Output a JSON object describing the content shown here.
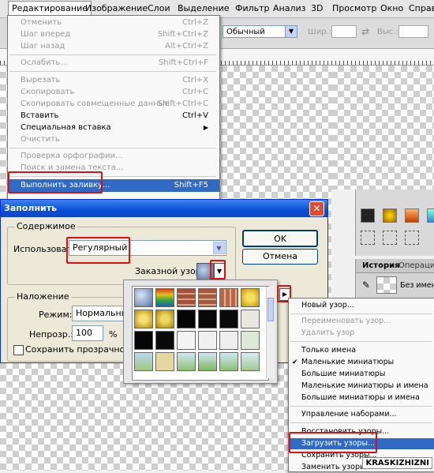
{
  "menubar": {
    "items": [
      "Редактирование",
      "Изображение",
      "Слои",
      "Выделение",
      "Фильтр",
      "Анализ",
      "3D",
      "Просмотр",
      "Окно",
      "Справ"
    ]
  },
  "options_bar": {
    "mode_value": "Обычный",
    "width_label": "Шир.:",
    "height_label": "Выс.:"
  },
  "edit_menu": {
    "items": [
      {
        "label": "Отменить",
        "shortcut": "Ctrl+Z"
      },
      {
        "label": "Шаг вперед",
        "shortcut": "Shift+Ctrl+Z"
      },
      {
        "label": "Шаг назад",
        "shortcut": "Alt+Ctrl+Z"
      },
      {
        "label": "Ослабить...",
        "shortcut": "Shift+Ctrl+F"
      },
      {
        "label": "Вырезать",
        "shortcut": "Ctrl+X"
      },
      {
        "label": "Скопировать",
        "shortcut": "Ctrl+C"
      },
      {
        "label": "Скопировать совмещенные данные",
        "shortcut": "Shift+Ctrl+C"
      },
      {
        "label": "Вставить",
        "shortcut": "Ctrl+V"
      },
      {
        "label": "Специальная вставка",
        "shortcut": ""
      },
      {
        "label": "Очистить",
        "shortcut": ""
      },
      {
        "label": "Проверка орфографии...",
        "shortcut": ""
      },
      {
        "label": "Поиск и замена текста...",
        "shortcut": ""
      },
      {
        "label": "Выполнить заливку...",
        "shortcut": "Shift+F5"
      }
    ]
  },
  "dialog": {
    "title": "Заполнить",
    "contents_legend": "Содержимое",
    "use_label": "Использовать:",
    "use_value": "Регулярный",
    "custom_pattern_label": "Заказной узор:",
    "blending_legend": "Наложение",
    "mode_label": "Режим:",
    "mode_value": "Нормальный",
    "opacity_label": "Непрозр.:",
    "opacity_value": "100",
    "opacity_unit": "%",
    "preserve_label": "Сохранить прозрачность",
    "ok": "OK",
    "cancel": "Отмена"
  },
  "panels": {
    "history_tab": "История",
    "operations_tab": "Операци",
    "history_item": "Без имени"
  },
  "flyout_menu": {
    "items": [
      "Новый узор...",
      "Переименовать узор...",
      "Удалить узор",
      "Только имена",
      "Маленькие миниатюры",
      "Большие миниатюры",
      "Маленькие миниатюры и имена",
      "Большие миниатюры и имена",
      "Управление наборами...",
      "Восстановить узоры...",
      "Загрузить узоры...",
      "Сохранить узоры...",
      "Заменить узоры..."
    ]
  },
  "watermark": "KRASKIZHIZNI",
  "colors": {
    "highlight": "#316ac5",
    "annotation_red": "#e01010",
    "dialog_title": "#0a4fd6"
  }
}
